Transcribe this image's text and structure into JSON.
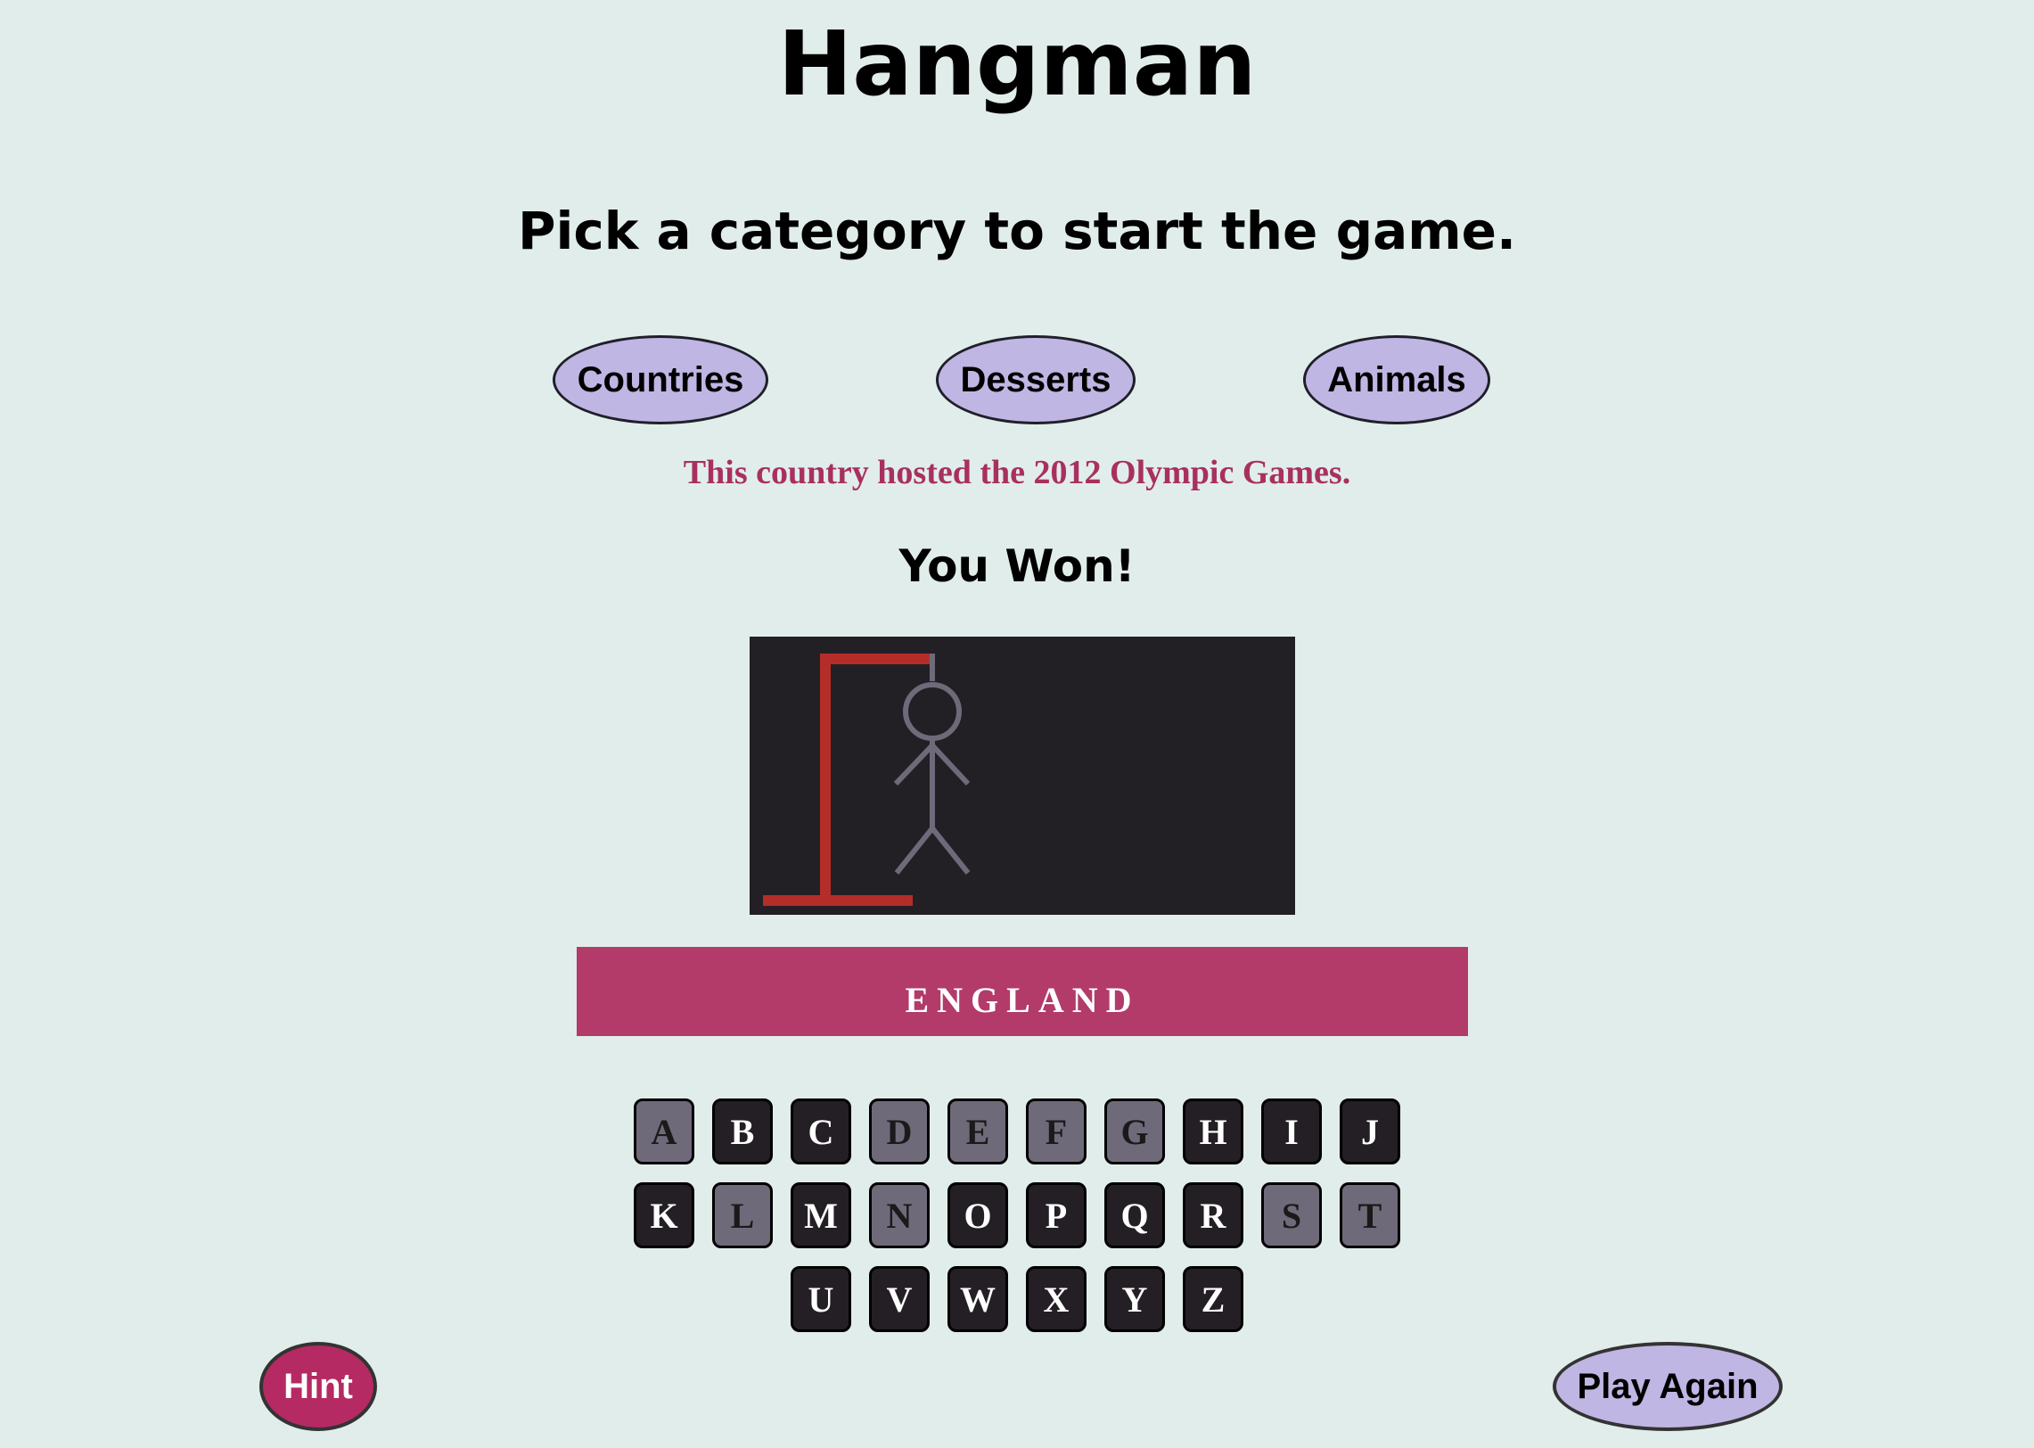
{
  "title": "Hangman",
  "subtitle": "Pick a category to start the game.",
  "categories": [
    {
      "label": "Countries"
    },
    {
      "label": "Desserts"
    },
    {
      "label": "Animals"
    }
  ],
  "hint_text": "This country hosted the 2012 Olympic Games.",
  "result": "You Won!",
  "word": "ENGLAND",
  "keyboard": {
    "rows": [
      [
        {
          "letter": "A",
          "used": true
        },
        {
          "letter": "B",
          "used": false
        },
        {
          "letter": "C",
          "used": false
        },
        {
          "letter": "D",
          "used": true
        },
        {
          "letter": "E",
          "used": true
        },
        {
          "letter": "F",
          "used": true
        },
        {
          "letter": "G",
          "used": true
        },
        {
          "letter": "H",
          "used": false
        },
        {
          "letter": "I",
          "used": false
        },
        {
          "letter": "J",
          "used": false
        }
      ],
      [
        {
          "letter": "K",
          "used": false
        },
        {
          "letter": "L",
          "used": true
        },
        {
          "letter": "M",
          "used": false
        },
        {
          "letter": "N",
          "used": true
        },
        {
          "letter": "O",
          "used": false
        },
        {
          "letter": "P",
          "used": false
        },
        {
          "letter": "Q",
          "used": false
        },
        {
          "letter": "R",
          "used": false
        },
        {
          "letter": "S",
          "used": true
        },
        {
          "letter": "T",
          "used": true
        }
      ],
      [
        {
          "letter": "U",
          "used": false
        },
        {
          "letter": "V",
          "used": false
        },
        {
          "letter": "W",
          "used": false
        },
        {
          "letter": "X",
          "used": false
        },
        {
          "letter": "Y",
          "used": false
        },
        {
          "letter": "Z",
          "used": false
        }
      ]
    ]
  },
  "buttons": {
    "hint": "Hint",
    "play_again": "Play Again"
  },
  "colors": {
    "background": "#e1edea",
    "category_button": "#bfb6e3",
    "accent": "#b23b6a",
    "hint_text": "#a8305f",
    "gallows": "#b52d28",
    "figure": "#6f6a79",
    "key_active": "#231f24",
    "key_used": "#6f6a79"
  }
}
